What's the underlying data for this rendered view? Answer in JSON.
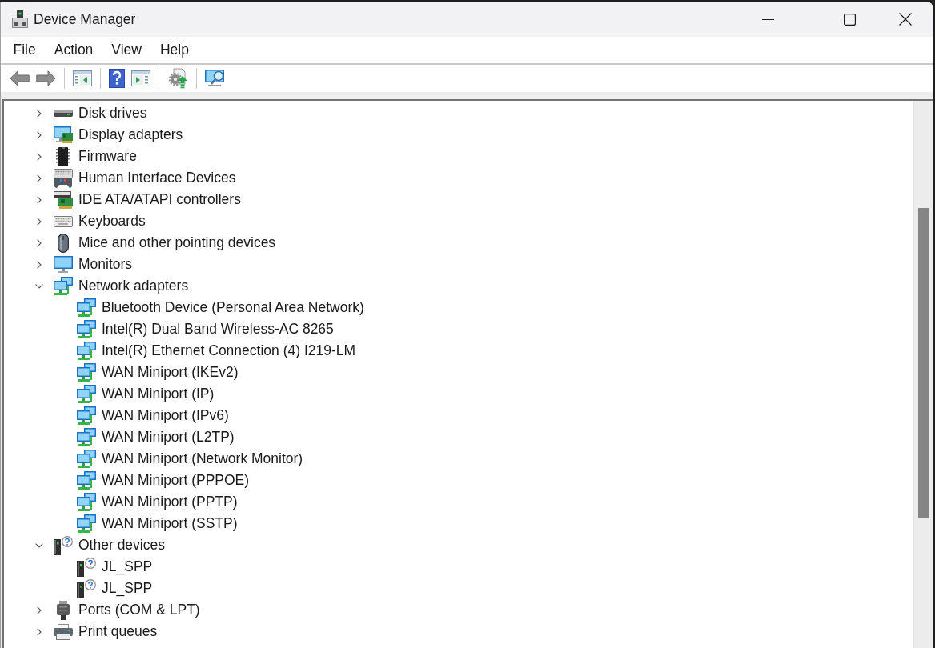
{
  "window": {
    "title": "Device Manager"
  },
  "menu": [
    "File",
    "Action",
    "View",
    "Help"
  ],
  "tree": [
    {
      "label": "Disk drives",
      "kind": "disk",
      "expanded": false
    },
    {
      "label": "Display adapters",
      "kind": "display",
      "expanded": false
    },
    {
      "label": "Firmware",
      "kind": "firmware",
      "expanded": false
    },
    {
      "label": "Human Interface Devices",
      "kind": "hid",
      "expanded": false
    },
    {
      "label": "IDE ATA/ATAPI controllers",
      "kind": "ide",
      "expanded": false
    },
    {
      "label": "Keyboards",
      "kind": "keyboard",
      "expanded": false
    },
    {
      "label": "Mice and other pointing devices",
      "kind": "mouse",
      "expanded": false
    },
    {
      "label": "Monitors",
      "kind": "monitor",
      "expanded": false
    },
    {
      "label": "Network adapters",
      "kind": "network",
      "expanded": true,
      "children": [
        {
          "label": "Bluetooth Device (Personal Area Network)",
          "kind": "network"
        },
        {
          "label": "Intel(R) Dual Band Wireless-AC 8265",
          "kind": "network"
        },
        {
          "label": "Intel(R) Ethernet Connection (4) I219-LM",
          "kind": "network"
        },
        {
          "label": "WAN Miniport (IKEv2)",
          "kind": "network"
        },
        {
          "label": "WAN Miniport (IP)",
          "kind": "network"
        },
        {
          "label": "WAN Miniport (IPv6)",
          "kind": "network"
        },
        {
          "label": "WAN Miniport (L2TP)",
          "kind": "network"
        },
        {
          "label": "WAN Miniport (Network Monitor)",
          "kind": "network"
        },
        {
          "label": "WAN Miniport (PPPOE)",
          "kind": "network"
        },
        {
          "label": "WAN Miniport (PPTP)",
          "kind": "network"
        },
        {
          "label": "WAN Miniport (SSTP)",
          "kind": "network"
        }
      ]
    },
    {
      "label": "Other devices",
      "kind": "unknown",
      "expanded": true,
      "children": [
        {
          "label": "JL_SPP",
          "kind": "unknown"
        },
        {
          "label": "JL_SPP",
          "kind": "unknown"
        }
      ]
    },
    {
      "label": "Ports (COM & LPT)",
      "kind": "port",
      "expanded": false
    },
    {
      "label": "Print queues",
      "kind": "printer",
      "expanded": false
    }
  ]
}
